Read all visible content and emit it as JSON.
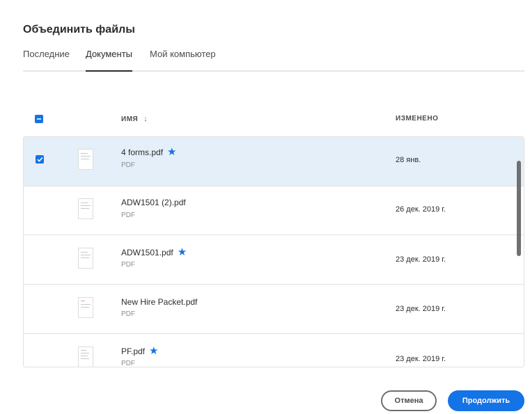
{
  "dialog": {
    "title": "Объединить файлы"
  },
  "tabs": [
    {
      "label": "Последние",
      "active": false
    },
    {
      "label": "Документы",
      "active": true
    },
    {
      "label": "Мой компьютер",
      "active": false
    }
  ],
  "table": {
    "header": {
      "name": "ИМЯ",
      "modified": "ИЗМЕНЕНО",
      "sort_icon": "arrow-down-icon",
      "select_all_state": "indeterminate"
    },
    "rows": [
      {
        "name": "4 forms.pdf",
        "type": "PDF",
        "date": "28 янв.",
        "starred": true,
        "selected": true
      },
      {
        "name": "ADW1501 (2).pdf",
        "type": "PDF",
        "date": "26 дек. 2019 г.",
        "starred": false,
        "selected": false
      },
      {
        "name": "ADW1501.pdf",
        "type": "PDF",
        "date": "23 дек. 2019 г.",
        "starred": true,
        "selected": false
      },
      {
        "name": "New Hire Packet.pdf",
        "type": "PDF",
        "date": "23 дек. 2019 г.",
        "starred": false,
        "selected": false
      },
      {
        "name": "PF.pdf",
        "type": "PDF",
        "date": "23 дек. 2019 г.",
        "starred": true,
        "selected": false
      }
    ]
  },
  "buttons": {
    "cancel": "Отмена",
    "continue": "Продолжить"
  },
  "colors": {
    "accent": "#1473e6",
    "selected_row": "#e5eff9",
    "star": "#1473e6"
  }
}
